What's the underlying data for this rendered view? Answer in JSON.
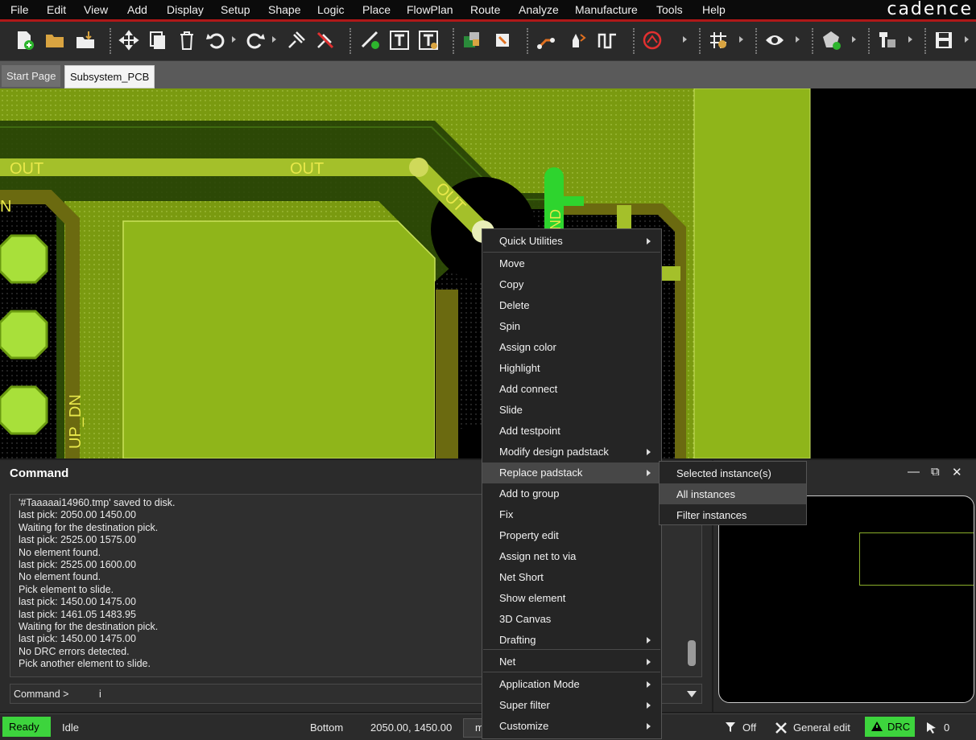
{
  "menubar": {
    "items": [
      "File",
      "Edit",
      "View",
      "Add",
      "Display",
      "Setup",
      "Shape",
      "Logic",
      "Place",
      "FlowPlan",
      "Route",
      "Analyze",
      "Manufacture",
      "Tools",
      "Help"
    ],
    "logo": "cadence"
  },
  "tabs": [
    "Start Page",
    "Subsystem_PCB"
  ],
  "canvas": {
    "labels": [
      "OUT",
      "OUT",
      "OUT",
      "N",
      "UP_DN",
      "ND"
    ],
    "colors": {
      "copper": "#7a9a10",
      "fill": "#8fb51a",
      "trace": "#bcd43a",
      "pad": "#a8e03a",
      "drill": "#cfd95a",
      "highlight": "#2ed42e"
    }
  },
  "command": {
    "title": "Command",
    "log": [
      "'#Taaaaai14960.tmp' saved to disk.",
      "last pick:  2050.00 1450.00",
      "Waiting for the destination pick.",
      "last pick:  2525.00 1575.00",
      "No element found.",
      "last pick:  2525.00 1600.00",
      "No element found.",
      "Pick element to slide.",
      "last pick:  1450.00 1475.00",
      "last pick:  1461.05 1483.95",
      "Waiting for the destination pick.",
      "last pick:  1450.00 1475.00",
      "No DRC errors detected.",
      "Pick another element to slide."
    ],
    "prompt": "Command >",
    "input_value": "i"
  },
  "worldview": {
    "buttons": [
      "—",
      "⧉",
      "✕"
    ]
  },
  "status": {
    "ready": "Ready",
    "idle": "Idle",
    "layer": "Bottom",
    "coords": "2050.00, 1450.00",
    "mode_box": "m",
    "filter": "Off",
    "edit_mode": "General edit",
    "drc": "DRC",
    "selected_count": "0"
  },
  "context_menu": {
    "items": [
      {
        "label": "Quick Utilities",
        "submenu": true
      },
      {
        "label": "Move",
        "submenu": false
      },
      {
        "label": "Copy",
        "submenu": false
      },
      {
        "label": "Delete",
        "submenu": false
      },
      {
        "label": "Spin",
        "submenu": false
      },
      {
        "label": "Assign color",
        "submenu": false
      },
      {
        "label": "Highlight",
        "submenu": false
      },
      {
        "label": "Add connect",
        "submenu": false
      },
      {
        "label": "Slide",
        "submenu": false
      },
      {
        "label": "Add testpoint",
        "submenu": false
      },
      {
        "label": "Modify design padstack",
        "submenu": true
      },
      {
        "label": "Replace padstack",
        "submenu": true
      },
      {
        "label": "Add to group",
        "submenu": false
      },
      {
        "label": "Fix",
        "submenu": false
      },
      {
        "label": "Property edit",
        "submenu": false
      },
      {
        "label": "Assign net to via",
        "submenu": false
      },
      {
        "label": "Net Short",
        "submenu": false
      },
      {
        "label": "Show element",
        "submenu": false
      },
      {
        "label": "3D Canvas",
        "submenu": false
      },
      {
        "label": "Drafting",
        "submenu": true
      },
      {
        "label": "Net",
        "submenu": true
      },
      {
        "label": "Application Mode",
        "submenu": true
      },
      {
        "label": "Super filter",
        "submenu": true
      },
      {
        "label": "Customize",
        "submenu": true
      }
    ],
    "highlighted": "Replace padstack"
  },
  "submenu": {
    "items": [
      "Selected instance(s)",
      "All instances",
      "Filter instances"
    ],
    "highlighted": "All instances"
  }
}
